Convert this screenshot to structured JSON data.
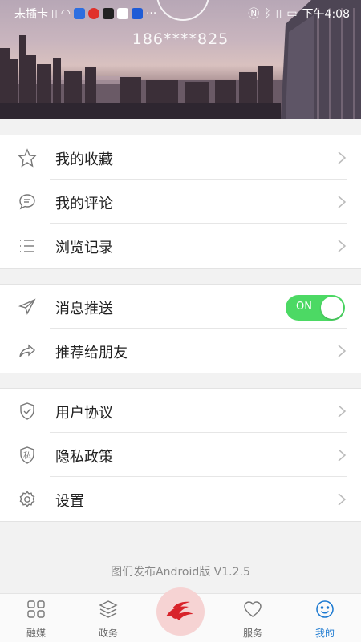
{
  "status_bar": {
    "carrier": "未插卡",
    "more": "···",
    "time": "下午4:08"
  },
  "profile": {
    "phone": "186****825"
  },
  "menu": {
    "group1": [
      {
        "label": "我的收藏",
        "icon": "star-icon"
      },
      {
        "label": "我的评论",
        "icon": "comment-icon"
      },
      {
        "label": "浏览记录",
        "icon": "list-icon"
      }
    ],
    "group2": [
      {
        "label": "消息推送",
        "icon": "send-icon",
        "toggle": "ON"
      },
      {
        "label": "推荐给朋友",
        "icon": "share-icon"
      }
    ],
    "group3": [
      {
        "label": "用户协议",
        "icon": "shield-check-icon"
      },
      {
        "label": "隐私政策",
        "icon": "privacy-icon",
        "icon_text": "私"
      },
      {
        "label": "设置",
        "icon": "gear-icon"
      }
    ]
  },
  "version": "图们发布Android版 V1.2.5",
  "tabs": [
    {
      "label": "融媒",
      "icon": "grid-icon"
    },
    {
      "label": "政务",
      "icon": "layers-icon"
    },
    {
      "label": "服务",
      "icon": "heart-icon"
    },
    {
      "label": "我的",
      "icon": "smiley-icon",
      "active": true
    }
  ],
  "colors": {
    "toggle_on": "#4cd964",
    "active_tab": "#1a78d0",
    "center_logo": "#d8232a"
  }
}
